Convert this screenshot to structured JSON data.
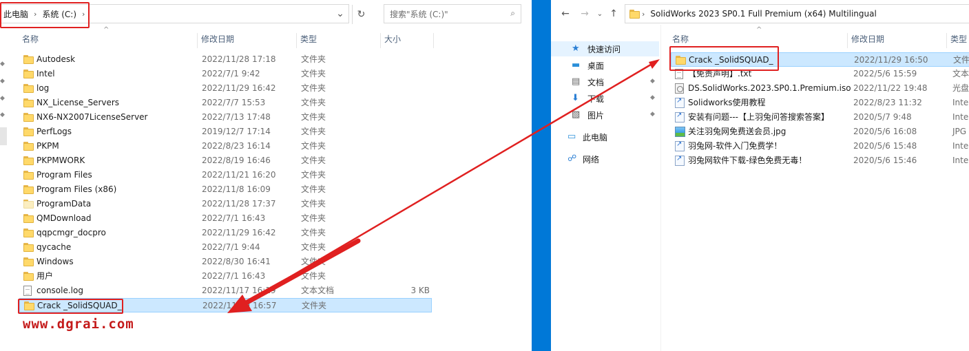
{
  "left": {
    "breadcrumb": [
      "此电脑",
      "系统 (C:)"
    ],
    "search_placeholder": "搜索\"系统 (C:)\"",
    "columns": {
      "name": "名称",
      "modified": "修改日期",
      "type": "类型",
      "size": "大小"
    },
    "rows": [
      {
        "name": "Autodesk",
        "date": "2022/11/28 17:18",
        "type": "文件夹",
        "size": "",
        "icon": "folder-icon"
      },
      {
        "name": "Intel",
        "date": "2022/7/1 9:42",
        "type": "文件夹",
        "size": "",
        "icon": "folder-icon"
      },
      {
        "name": "log",
        "date": "2022/11/29 16:42",
        "type": "文件夹",
        "size": "",
        "icon": "folder-icon"
      },
      {
        "name": "NX_License_Servers",
        "date": "2022/7/7 15:53",
        "type": "文件夹",
        "size": "",
        "icon": "folder-icon"
      },
      {
        "name": "NX6-NX2007LicenseServer",
        "date": "2022/7/13 17:48",
        "type": "文件夹",
        "size": "",
        "icon": "folder-icon"
      },
      {
        "name": "PerfLogs",
        "date": "2019/12/7 17:14",
        "type": "文件夹",
        "size": "",
        "icon": "folder-icon"
      },
      {
        "name": "PKPM",
        "date": "2022/8/23 16:14",
        "type": "文件夹",
        "size": "",
        "icon": "folder-icon"
      },
      {
        "name": "PKPMWORK",
        "date": "2022/8/19 16:46",
        "type": "文件夹",
        "size": "",
        "icon": "folder-icon"
      },
      {
        "name": "Program Files",
        "date": "2022/11/21 16:20",
        "type": "文件夹",
        "size": "",
        "icon": "folder-icon"
      },
      {
        "name": "Program Files (x86)",
        "date": "2022/11/8 16:09",
        "type": "文件夹",
        "size": "",
        "icon": "folder-icon"
      },
      {
        "name": "ProgramData",
        "date": "2022/11/28 17:37",
        "type": "文件夹",
        "size": "",
        "icon": "folder-icon"
      },
      {
        "name": "QMDownload",
        "date": "2022/7/1 16:43",
        "type": "文件夹",
        "size": "",
        "icon": "folder-icon"
      },
      {
        "name": "qqpcmgr_docpro",
        "date": "2022/11/29 16:42",
        "type": "文件夹",
        "size": "",
        "icon": "folder-icon"
      },
      {
        "name": "qycache",
        "date": "2022/7/1 9:44",
        "type": "文件夹",
        "size": "",
        "icon": "folder-icon"
      },
      {
        "name": "Windows",
        "date": "2022/8/30 16:41",
        "type": "文件夹",
        "size": "",
        "icon": "folder-icon"
      },
      {
        "name": "用户",
        "date": "2022/7/1 16:43",
        "type": "文件夹",
        "size": "",
        "icon": "folder-icon"
      },
      {
        "name": "console.log",
        "date": "2022/11/17 16:19",
        "type": "文本文档",
        "size": "3 KB",
        "icon": "text-file-icon"
      },
      {
        "name": "Crack _SolidSQUAD_",
        "date": "2022/11/29 16:57",
        "type": "文件夹",
        "size": "",
        "icon": "folder-icon"
      }
    ]
  },
  "right": {
    "breadcrumb": [
      "SolidWorks 2023 SP0.1 Full Premium (x64) Multilingual"
    ],
    "columns": {
      "name": "名称",
      "modified": "修改日期",
      "type": "类型"
    },
    "nav": [
      {
        "label": "快速访问",
        "icon": "star-icon"
      },
      {
        "label": "桌面",
        "icon": "desktop-icon"
      },
      {
        "label": "文档",
        "icon": "documents-icon"
      },
      {
        "label": "下载",
        "icon": "downloads-icon"
      },
      {
        "label": "图片",
        "icon": "pictures-icon"
      },
      {
        "label": "此电脑",
        "icon": "computer-icon"
      },
      {
        "label": "网络",
        "icon": "network-icon"
      }
    ],
    "rows": [
      {
        "name": "Crack _SolidSQUAD_",
        "date": "2022/11/29 16:50",
        "type": "文件",
        "icon": "folder-icon"
      },
      {
        "name": "【免责声明】.txt",
        "date": "2022/5/6 15:59",
        "type": "文本",
        "icon": "text-file-icon"
      },
      {
        "name": "DS.SolidWorks.2023.SP0.1.Premium.iso",
        "date": "2022/11/22 19:48",
        "type": "光盘",
        "icon": "disc-image-icon"
      },
      {
        "name": "Solidworks使用教程",
        "date": "2022/8/23 11:32",
        "type": "Inter",
        "icon": "internet-shortcut-icon"
      },
      {
        "name": "安装有问题---【上羽兔问答搜索答案】",
        "date": "2020/5/7 9:48",
        "type": "Inter",
        "icon": "internet-shortcut-icon"
      },
      {
        "name": "关注羽兔网免费送会员.jpg",
        "date": "2020/5/6 16:08",
        "type": "JPG",
        "icon": "image-file-icon"
      },
      {
        "name": "羽兔网-软件入门免费学！",
        "date": "2020/5/6 15:48",
        "type": "Inter",
        "icon": "internet-shortcut-icon"
      },
      {
        "name": "羽兔网软件下载-绿色免费无毒！",
        "date": "2020/5/6 15:46",
        "type": "Inter",
        "icon": "internet-shortcut-icon"
      }
    ]
  },
  "watermark": "www.dgrai.com",
  "colors": {
    "selection": "#cce8ff",
    "annotation_red": "#e02020",
    "divider": "#0078d7"
  }
}
